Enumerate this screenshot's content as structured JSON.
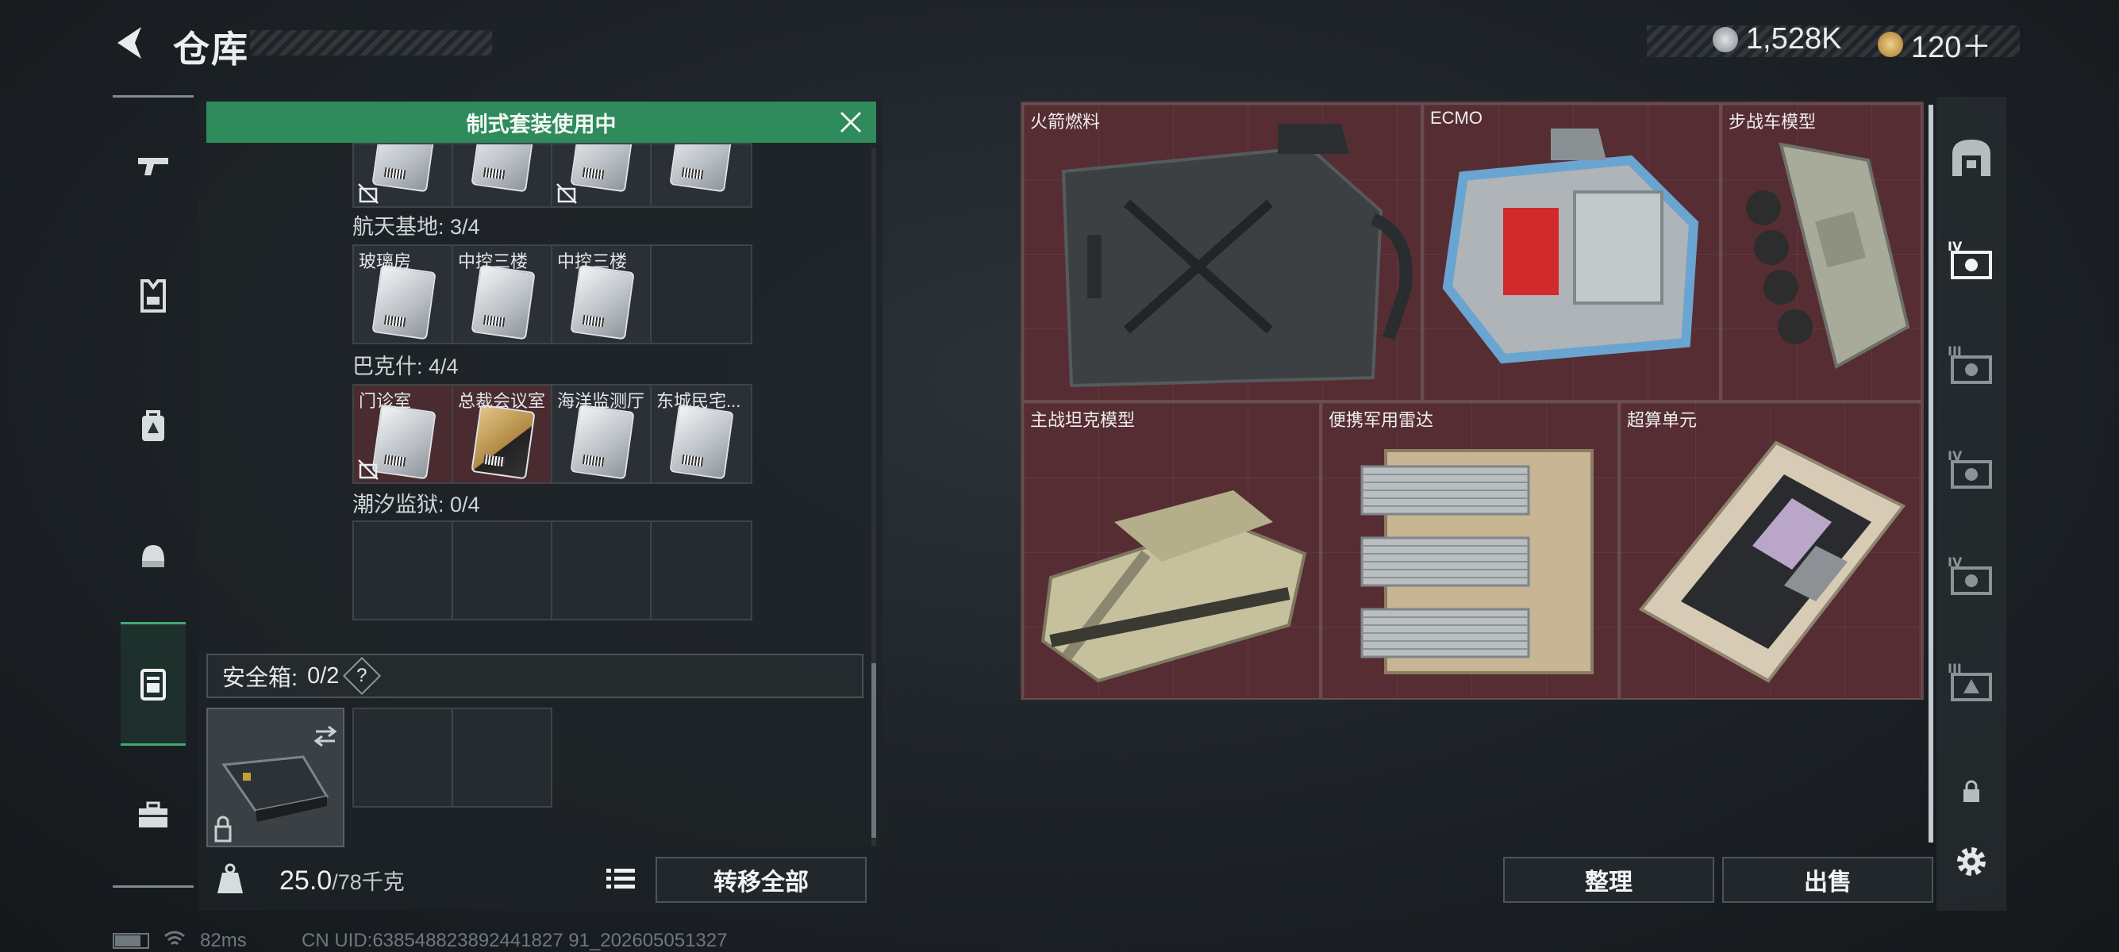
{
  "header": {
    "title": "仓库",
    "currency_1": "1,528K",
    "currency_2": "120＋"
  },
  "left_rail": {
    "items": [
      "gun-icon",
      "armor-icon",
      "backpack-icon",
      "helmet-icon",
      "case-icon",
      "toolbox-icon"
    ],
    "active_index": 4
  },
  "storage": {
    "banner": "制式套装使用中",
    "sections": [
      {
        "label": "",
        "cards": [
          {
            "name": "",
            "style": "white",
            "locked": true
          },
          {
            "name": "",
            "style": "white",
            "locked": false
          },
          {
            "name": "",
            "style": "white",
            "locked": true
          },
          {
            "name": "",
            "style": "white",
            "locked": false
          }
        ]
      },
      {
        "label": "航天基地: 3/4",
        "cards": [
          {
            "name": "玻璃房",
            "style": "white",
            "locked": false
          },
          {
            "name": "中控三楼",
            "style": "white",
            "locked": false
          },
          {
            "name": "中控三楼",
            "style": "white",
            "locked": false
          },
          {
            "name": "",
            "style": "empty",
            "locked": false
          }
        ]
      },
      {
        "label": "巴克什: 4/4",
        "cards": [
          {
            "name": "门诊室",
            "style": "white-red",
            "locked": true
          },
          {
            "name": "总裁会议室",
            "style": "gold-red",
            "locked": false
          },
          {
            "name": "海洋监测厅",
            "style": "white",
            "locked": false
          },
          {
            "name": "东城民宅...",
            "style": "white",
            "locked": false
          }
        ]
      },
      {
        "label": "潮汐监狱: 0/4",
        "cards": [
          {
            "name": "",
            "style": "empty",
            "locked": false
          },
          {
            "name": "",
            "style": "empty",
            "locked": false
          },
          {
            "name": "",
            "style": "empty",
            "locked": false
          },
          {
            "name": "",
            "style": "empty",
            "locked": false
          }
        ]
      }
    ],
    "safe_box_label": "安全箱:",
    "safe_box_count": "0/2",
    "help": "?",
    "weight_current": "25.0",
    "weight_max": "/78千克",
    "transfer_all": "转移全部"
  },
  "stash": {
    "items": [
      {
        "label": "火箭燃料",
        "art": "fuel-can"
      },
      {
        "label": "ECMO",
        "art": "ecmo-machine"
      },
      {
        "label": "步战车模型",
        "art": "ifv-model"
      },
      {
        "label": "主战坦克模型",
        "art": "tank-model"
      },
      {
        "label": "便携军用雷达",
        "art": "radar"
      },
      {
        "label": "超算单元",
        "art": "compute-unit"
      }
    ],
    "sort": "整理",
    "sell": "出售"
  },
  "right_rail": {
    "items": [
      "home-icon",
      "case-iv-icon",
      "case-iii-icon",
      "case-iv-icon",
      "case-iv-icon",
      "case-iii-icon",
      "lock-icon",
      "gear-icon"
    ]
  },
  "status": {
    "ping": "82ms",
    "uid": "CN UID:638548823892441827 91_202605051327"
  },
  "colors": {
    "accent_green": "#2f8a5c",
    "stash_bg": "#4d2a2e"
  }
}
